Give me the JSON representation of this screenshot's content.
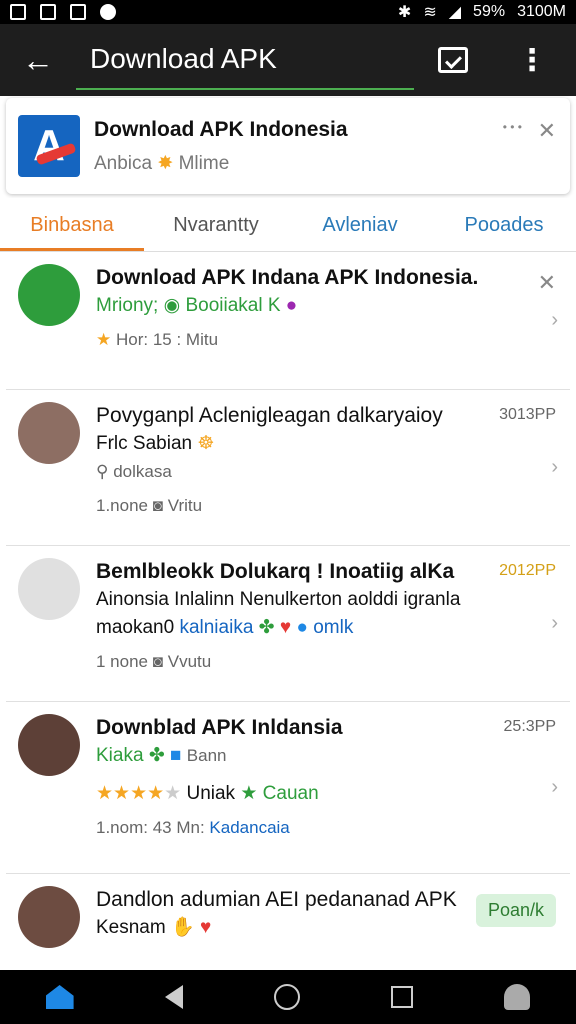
{
  "status_bar": {
    "battery": "59%",
    "time": "3100M"
  },
  "toolbar": {
    "title": "Download APK"
  },
  "banner": {
    "title": "Download APK Indonesia",
    "subtitle": "Anbica",
    "subtitle_tail": "Mlime",
    "logo_letter": "A"
  },
  "tabs": [
    {
      "label": "Binbasna"
    },
    {
      "label": "Nvarantty"
    },
    {
      "label": "Avleniav"
    },
    {
      "label": "Pooades"
    }
  ],
  "items": [
    {
      "title": "Download APK Indana APK Indonesia.",
      "line1": "Mriony;",
      "line1_green": "Booiiakal K",
      "meta": "Hor: 15 : Mitu"
    },
    {
      "title": "Povyganpl Aclenigleagan dalkaryaioy",
      "line1": "Frlc Sabian",
      "line2": "dolkasa",
      "meta": "1.none",
      "meta2": "Vritu",
      "time": "3013PP"
    },
    {
      "title": "Bemlbleokk Dolukarq ! Inoatiig alKa",
      "line1": "Ainonsia Inlalinn Nenulkerton aolddi igranla",
      "line2_a": "maokan0",
      "line2_b": "kalniaika",
      "line2_c": "omlk",
      "meta": "1 none",
      "meta2": "Vvutu",
      "time": "2012PP"
    },
    {
      "title": "Downblad APK Inldansia",
      "line1": "Kiaka",
      "line1_b": "Bann",
      "rating_text": "Uniak",
      "rating_tail": "Cauan",
      "meta": "1.nom: 43 Mn:",
      "meta_link": "Kadancaia",
      "time": "25:3PP"
    },
    {
      "title": "Dandlon adumian AEI pedananad APK",
      "line1": "Kesnam",
      "badge": "Poan/k"
    }
  ],
  "colors": {
    "accent_orange": "#e87d25",
    "accent_blue": "#2a7ab8",
    "green": "#2e9d3c"
  }
}
